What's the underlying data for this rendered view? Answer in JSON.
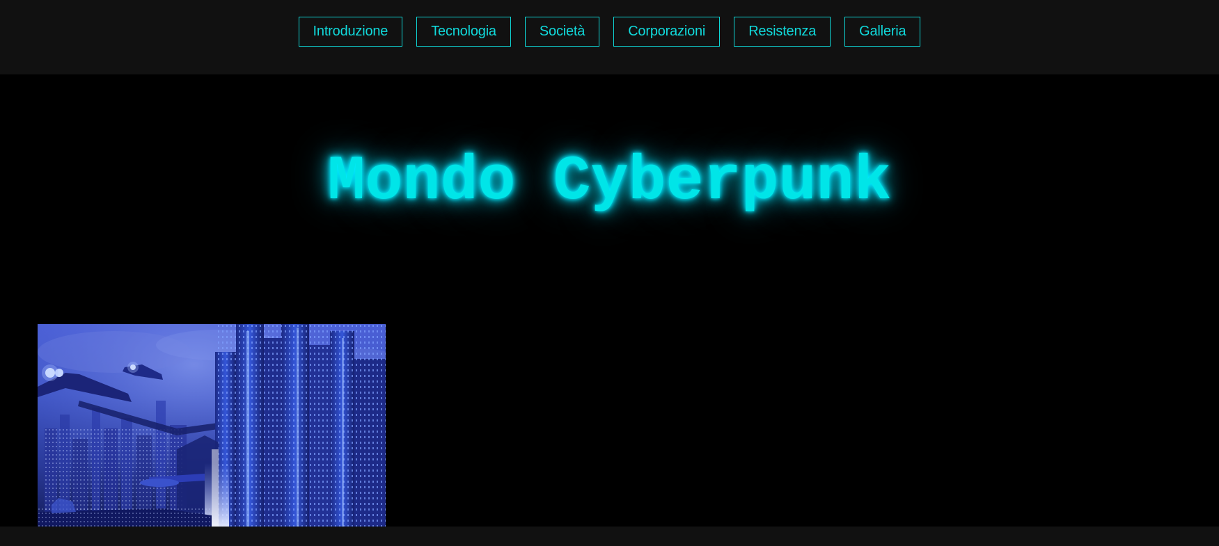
{
  "nav": {
    "items": [
      {
        "label": "Introduzione"
      },
      {
        "label": "Tecnologia"
      },
      {
        "label": "Società"
      },
      {
        "label": "Corporazioni"
      },
      {
        "label": "Resistenza"
      },
      {
        "label": "Galleria"
      }
    ]
  },
  "hero": {
    "title": "Mondo Cyberpunk"
  },
  "colors": {
    "accent": "#00e5e8",
    "nav_background": "#111111",
    "page_background": "#000000"
  },
  "image": {
    "subject": "cyberpunk-city-illustration"
  }
}
